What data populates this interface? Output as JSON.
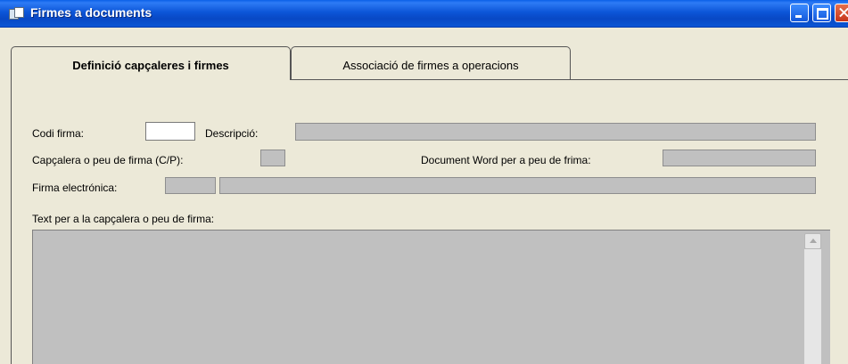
{
  "window": {
    "title": "Firmes a documents"
  },
  "tabs": [
    {
      "label": "Definició capçaleres i firmes",
      "active": true
    },
    {
      "label": "Associació de firmes a operacions",
      "active": false
    }
  ],
  "form": {
    "codi_firma_label": "Codi firma:",
    "codi_firma_value": "",
    "descripcio_label": "Descripció:",
    "descripcio_value": "",
    "capcalera_label": "Capçalera o peu de firma (C/P):",
    "capcalera_value": "",
    "document_word_label": "Document Word per a peu de frima:",
    "document_word_value": "",
    "firma_electronica_label": "Firma electrónica:",
    "firma_electronica_code": "",
    "firma_electronica_desc": "",
    "text_label": "Text per a la capçalera o peu de firma:",
    "text_value": ""
  },
  "colors": {
    "titlebar": "#0A55D4",
    "window_bg": "#ECE9D8",
    "disabled_field": "#C0C0C0"
  }
}
